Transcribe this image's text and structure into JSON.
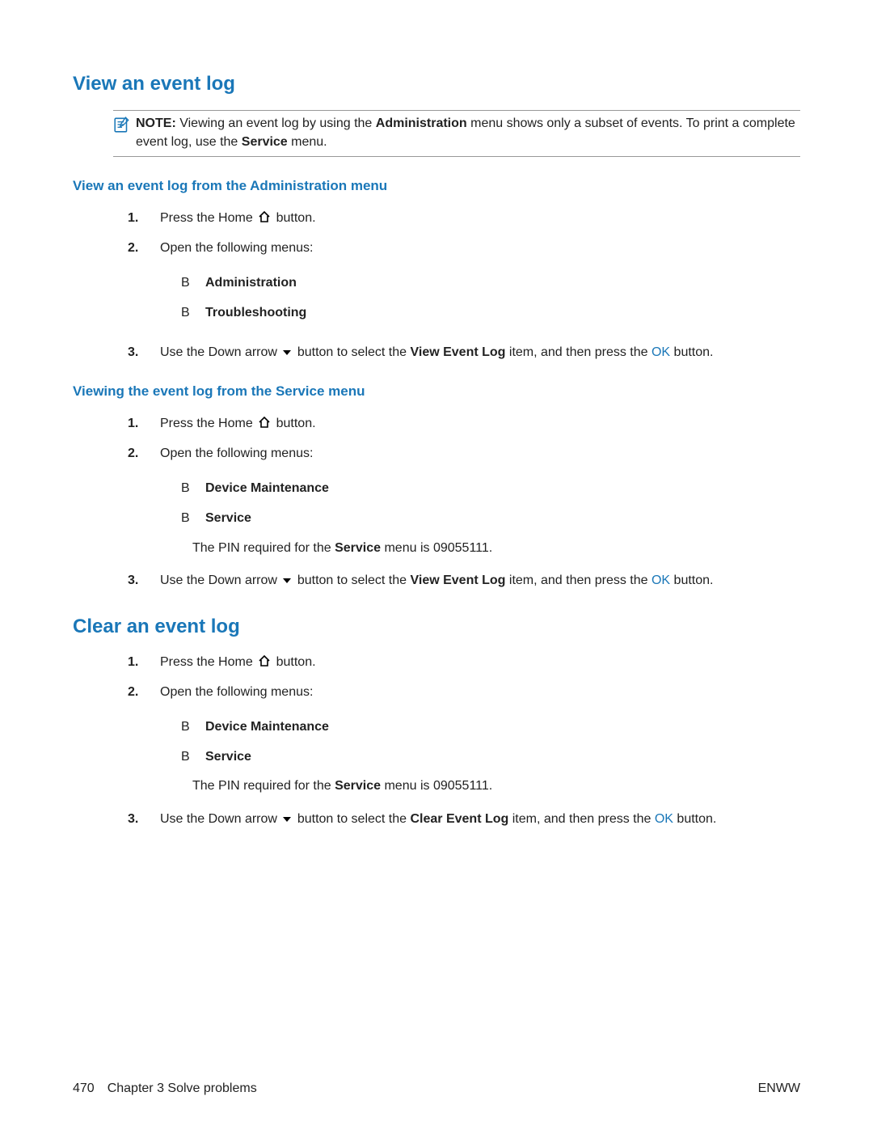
{
  "section1": {
    "title": "View an event log",
    "note": {
      "label": "NOTE:",
      "text_a": "Viewing an event log by using the ",
      "bold_a": "Administration",
      "text_b": " menu shows only a subset of events. To print a complete event log, use the ",
      "bold_b": "Service",
      "text_c": " menu."
    },
    "sub1": {
      "heading": "View an event log from the Administration menu",
      "step1_a": "Press the Home ",
      "step1_b": " button.",
      "step2": "Open the following menus:",
      "menu1": "Administration",
      "menu2": "Troubleshooting",
      "step3_a": "Use the Down arrow ",
      "step3_b": " button to select the ",
      "step3_bold": "View Event Log",
      "step3_c": " item, and then press the ",
      "step3_ok": "OK",
      "step3_d": " button."
    },
    "sub2": {
      "heading": "Viewing the event log from the Service menu",
      "step1_a": "Press the Home ",
      "step1_b": " button.",
      "step2": "Open the following menus:",
      "menu1": "Device Maintenance",
      "menu2": "Service",
      "pin_a": "The PIN required for the ",
      "pin_bold": "Service",
      "pin_b": " menu is 09055111.",
      "step3_a": "Use the Down arrow ",
      "step3_b": " button to select the ",
      "step3_bold": "View Event Log",
      "step3_c": " item, and then press the ",
      "step3_ok": "OK",
      "step3_d": " button."
    }
  },
  "section2": {
    "title": "Clear an event log",
    "step1_a": "Press the Home ",
    "step1_b": " button.",
    "step2": "Open the following menus:",
    "menu1": "Device Maintenance",
    "menu2": "Service",
    "pin_a": "The PIN required for the ",
    "pin_bold": "Service",
    "pin_b": " menu is 09055111.",
    "step3_a": "Use the Down arrow ",
    "step3_b": " button to select the ",
    "step3_bold": "Clear Event Log",
    "step3_c": " item, and then press the ",
    "step3_ok": "OK",
    "step3_d": " button."
  },
  "numbers": {
    "n1": "1.",
    "n2": "2.",
    "n3": "3."
  },
  "bullet": "B",
  "footer": {
    "page": "470",
    "chapter": "Chapter 3   Solve problems",
    "right": "ENWW"
  }
}
